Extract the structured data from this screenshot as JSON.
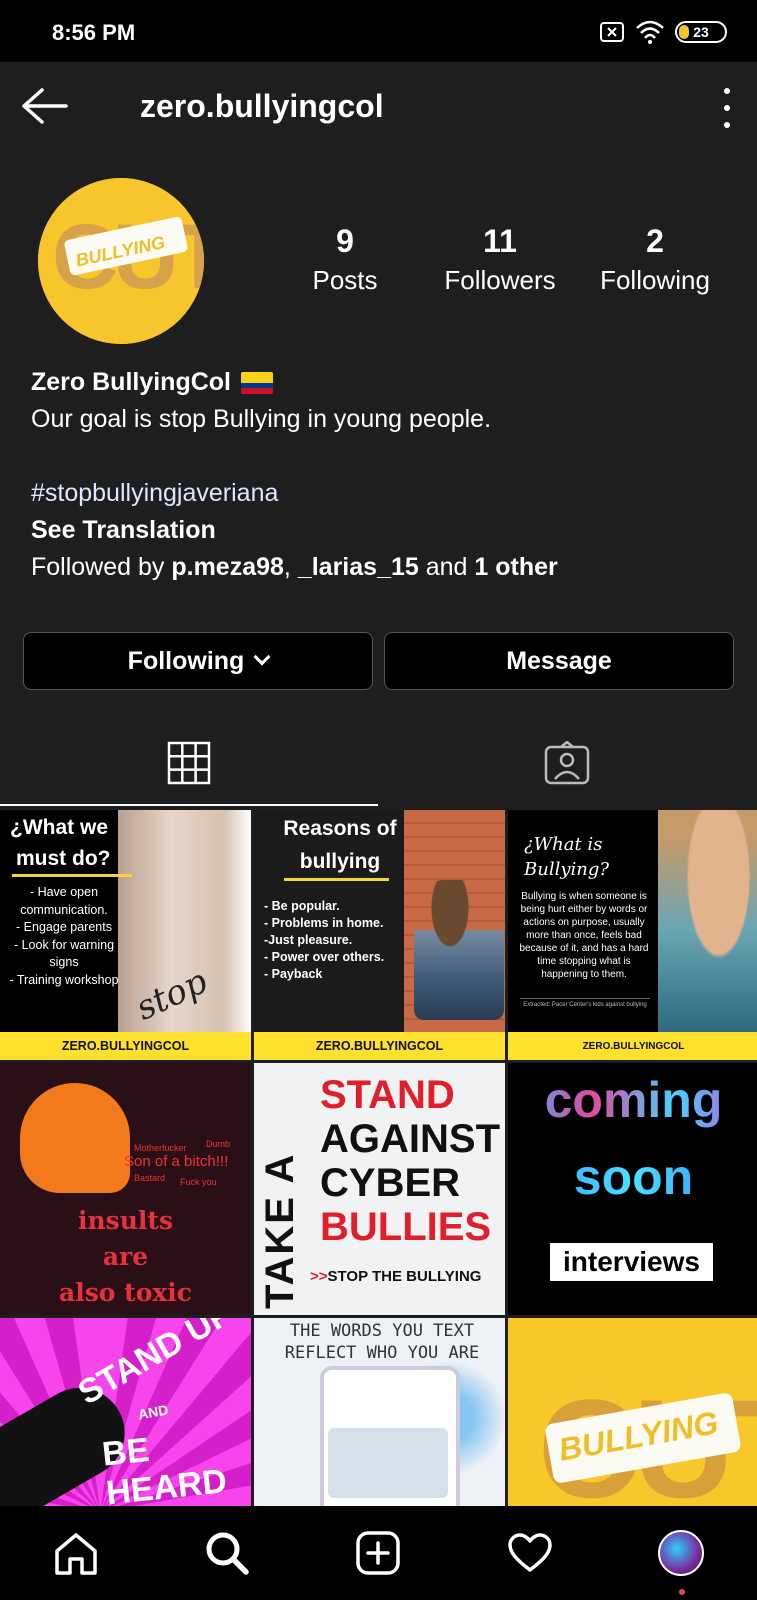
{
  "status_bar": {
    "time": "8:56 PM",
    "battery": "23"
  },
  "header": {
    "username": "zero.bullyingcol"
  },
  "profile": {
    "posts_count": "9",
    "posts_label": "Posts",
    "followers_count": "11",
    "followers_label": "Followers",
    "following_count": "2",
    "following_label": "Following"
  },
  "bio": {
    "name": "Zero BullyingCol",
    "flag_colors": [
      "#fcd116",
      "#003893",
      "#ce1126"
    ],
    "description": "Our goal is stop Bullying in young people.",
    "hashtag": "#stopbullyingjaveriana",
    "see_translation": "See Translation",
    "followed_by_prefix": "Followed by ",
    "follower_1": "p.meza98",
    "separator": ", ",
    "follower_2": "_larias_15",
    "and_text": " and ",
    "others": "1 other"
  },
  "actions": {
    "following_label": "Following",
    "message_label": "Message"
  },
  "tabs": {
    "grid_icon": "grid-icon",
    "tagged_icon": "tagged-icon"
  },
  "posts": {
    "p1": {
      "title_line1": "¿What we",
      "title_line2": "must do?",
      "items": [
        "- Have open communication.",
        "- Engage parents",
        "- Look for warning signs",
        "- Training workshop"
      ],
      "stop_text": "stop",
      "footer": "ZERO.BULLYINGCOL"
    },
    "p2": {
      "title_line1": "Reasons of",
      "title_line2": "bullying",
      "items": [
        "- Be popular.",
        "- Problems in home.",
        "-Just pleasure.",
        "- Power over others.",
        "- Payback"
      ],
      "footer": "ZERO.BULLYINGCOL"
    },
    "p3": {
      "title_line1": "¿What is",
      "title_line2": "Bullying?",
      "body": "Bullying is when someone is being hurt either by words or actions on purpose, usually more than once, feels bad because of it, and has a hard time stopping what is happening to them.",
      "source": "Extracted: Pacer Center's kids against bullying",
      "footer": "ZERO.BULLYINGCOL"
    },
    "p4": {
      "insult_main": "Son of a bitch!!!",
      "insult_a": "Motherfucker",
      "insult_b": "Dumb",
      "insult_c": "Bastard",
      "insult_d": "Fuck you",
      "line1": "insults",
      "line2": "are",
      "line3": "also toxic"
    },
    "p5": {
      "vertical": "TAKE A",
      "w1": "STAND",
      "w2": "AGAINST",
      "w3": "CYBER",
      "w4": "BULLIES",
      "arrows": ">>",
      "footer": "STOP THE BULLYING"
    },
    "p6": {
      "line1": "coming",
      "line2": "soon",
      "box": "interviews"
    },
    "p7": {
      "line1": "STAND UP",
      "and": "AND",
      "line2": "BE HEARD"
    },
    "p8": {
      "line1": "THE WORDS YOU TEXT",
      "line2": "REFLECT WHO YOU ARE"
    },
    "p9": {
      "letters": "CUT",
      "label": "BULLYING"
    }
  },
  "avatar_post": {
    "letters": "CUT",
    "label": "BULLYING"
  },
  "nav": {
    "home": "home-icon",
    "search": "search-icon",
    "create": "add-icon",
    "activity": "heart-icon",
    "profile": "profile-avatar"
  }
}
